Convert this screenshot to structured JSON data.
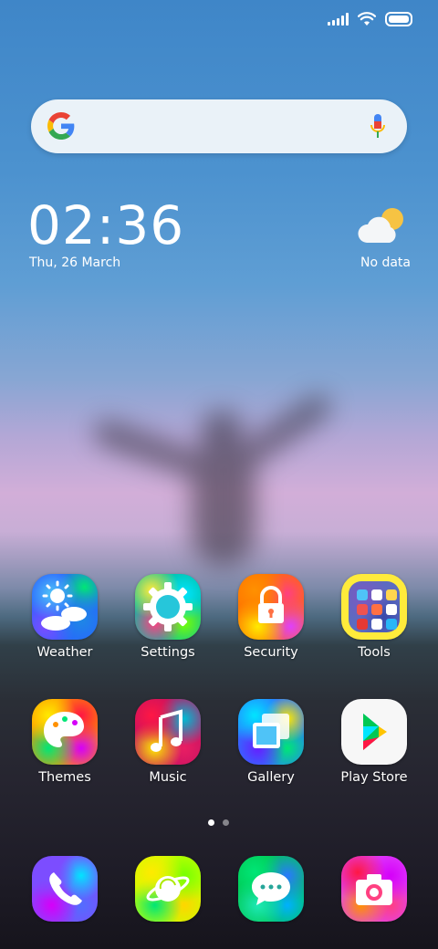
{
  "status_bar": {
    "icons": [
      "signal-icon",
      "wifi-icon",
      "battery-icon"
    ]
  },
  "search": {
    "logo": "google-g-icon",
    "mic": "microphone-icon"
  },
  "clock": {
    "time": "02:36",
    "date": "Thu, 26 March"
  },
  "weather": {
    "icon": "partly-cloudy-icon",
    "status": "No data"
  },
  "apps_row1": [
    {
      "label": "Weather",
      "icon": "weather-icon"
    },
    {
      "label": "Settings",
      "icon": "gear-icon"
    },
    {
      "label": "Security",
      "icon": "lock-icon"
    },
    {
      "label": "Tools",
      "icon": "folder-icon"
    }
  ],
  "apps_row2": [
    {
      "label": "Themes",
      "icon": "palette-icon"
    },
    {
      "label": "Music",
      "icon": "music-note-icon"
    },
    {
      "label": "Gallery",
      "icon": "gallery-icon"
    },
    {
      "label": "Play Store",
      "icon": "play-store-icon"
    }
  ],
  "dock": [
    {
      "icon": "phone-icon"
    },
    {
      "icon": "browser-icon"
    },
    {
      "icon": "messages-icon"
    },
    {
      "icon": "camera-icon"
    }
  ],
  "page_indicator": {
    "current": 1,
    "total": 2
  },
  "colors": {
    "sky_top": "#3f86c8",
    "horizon": "#d2aed8",
    "ground": "#1e1c27"
  }
}
